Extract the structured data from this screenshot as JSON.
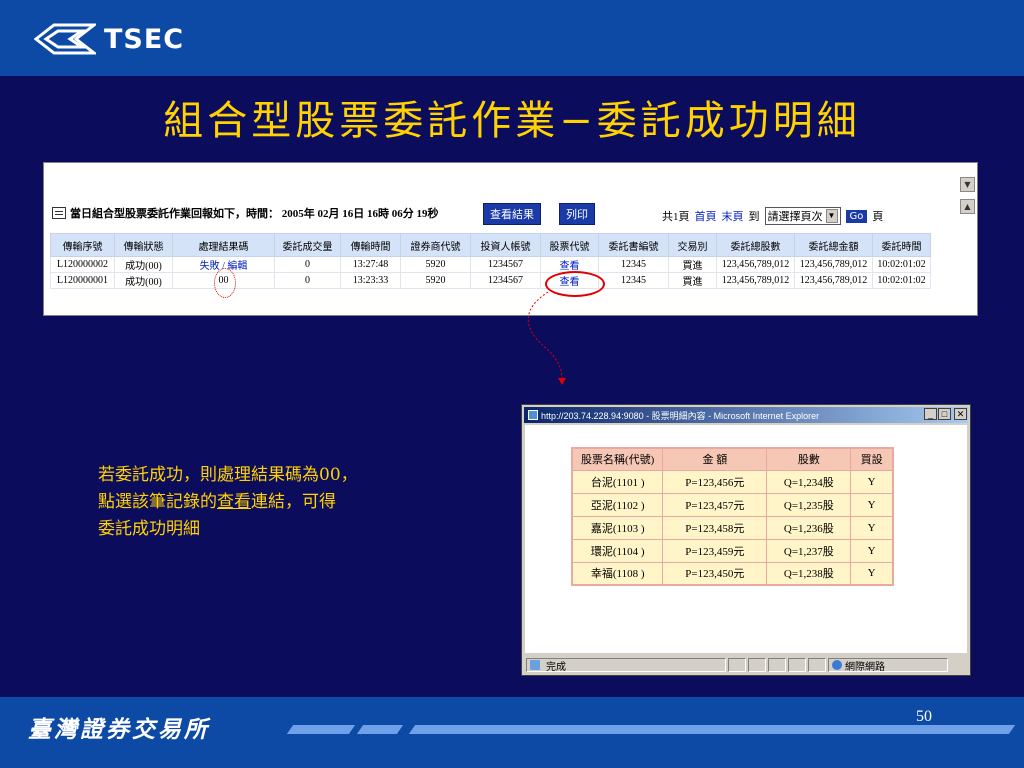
{
  "header": {
    "logo_text": "TSEC",
    "title": "組合型股票委託作業−委託成功明細"
  },
  "panel": {
    "report_heading": "當日組合型股票委託作業回報如下，時間： 2005年 02月 16日 16時 06分 19秒",
    "view_result_button": "查看結果",
    "print_button": "列印",
    "page_info": "共1頁",
    "first_page": "首頁",
    "last_page": "末頁",
    "goto_label": "到",
    "select_placeholder": "請選擇頁次",
    "go_button": "Go",
    "page_suffix": "頁",
    "columns": [
      "傳輸序號",
      "傳輸狀態",
      "處理結果碼",
      "委託成交量",
      "傳輸時間",
      "證券商代號",
      "投資人帳號",
      "股票代號",
      "委託書編號",
      "交易別",
      "委託總股數",
      "委託總金額",
      "委託時間"
    ],
    "rows": [
      [
        "L120000002",
        "成功(00)",
        "失敗 / 編輯",
        "0",
        "13:27:48",
        "5920",
        "1234567",
        "查看",
        "12345",
        "買進",
        "123,456,789,012",
        "123,456,789,012",
        "10:02:01:02"
      ],
      [
        "L120000001",
        "成功(00)",
        "00",
        "0",
        "13:23:33",
        "5920",
        "1234567",
        "查看",
        "12345",
        "買進",
        "123,456,789,012",
        "123,456,789,012",
        "10:02:01:02"
      ]
    ]
  },
  "note": {
    "line1": "若委託成功，則處理結果碼為00，",
    "line2_pre": "點選該筆記錄的",
    "line2_link": "查看",
    "line2_post": "連結，可得",
    "line3": "委託成功明細"
  },
  "popup": {
    "title": "http://203.74.228.94:9080 - 股票明細內容 - Microsoft Internet Explorer",
    "columns": [
      "股票名稱(代號)",
      "金 額",
      "股數",
      "買設"
    ],
    "rows": [
      [
        "台泥(1101 )",
        "P=123,456元",
        "Q=1,234股",
        "Y"
      ],
      [
        "亞泥(1102 )",
        "P=123,457元",
        "Q=1,235股",
        "Y"
      ],
      [
        "嘉泥(1103 )",
        "P=123,458元",
        "Q=1,236股",
        "Y"
      ],
      [
        "環泥(1104 )",
        "P=123,459元",
        "Q=1,237股",
        "Y"
      ],
      [
        "幸福(1108 )",
        "P=123,450元",
        "Q=1,238股",
        "Y"
      ]
    ],
    "status_done": "完成",
    "status_zone": "網際網路"
  },
  "footer": {
    "org_name": "臺灣證券交易所",
    "page_number": "50"
  }
}
